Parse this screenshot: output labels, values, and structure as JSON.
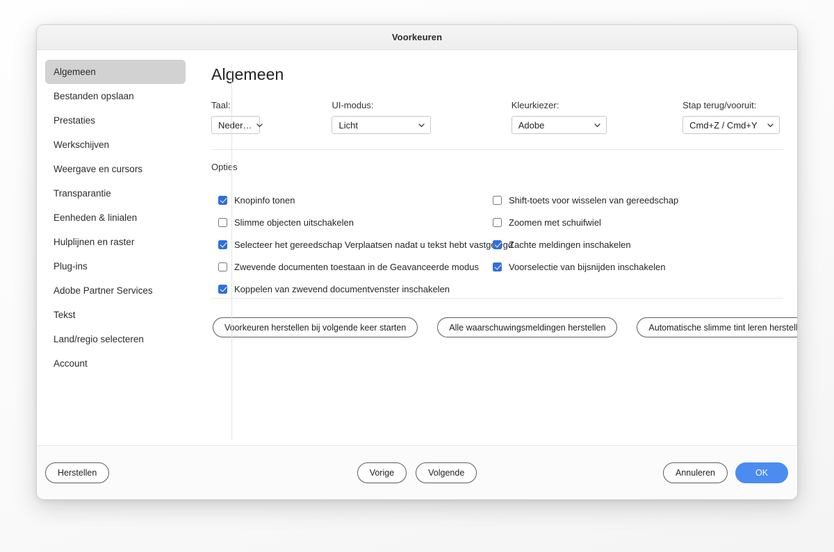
{
  "window": {
    "title": "Voorkeuren"
  },
  "sidebar": {
    "items": [
      {
        "label": "Algemeen",
        "selected": true
      },
      {
        "label": "Bestanden opslaan",
        "selected": false
      },
      {
        "label": "Prestaties",
        "selected": false
      },
      {
        "label": "Werkschijven",
        "selected": false
      },
      {
        "label": "Weergave en cursors",
        "selected": false
      },
      {
        "label": "Transparantie",
        "selected": false
      },
      {
        "label": "Eenheden & linialen",
        "selected": false
      },
      {
        "label": "Hulplijnen en raster",
        "selected": false
      },
      {
        "label": "Plug-ins",
        "selected": false
      },
      {
        "label": "Adobe Partner Services",
        "selected": false
      },
      {
        "label": "Tekst",
        "selected": false
      },
      {
        "label": "Land/regio selecteren",
        "selected": false
      },
      {
        "label": "Account",
        "selected": false
      }
    ]
  },
  "content": {
    "heading": "Algemeen",
    "selects": [
      {
        "label": "Taal:",
        "value": "Neder…"
      },
      {
        "label": "UI-modus:",
        "value": "Licht"
      },
      {
        "label": "Kleurkiezer:",
        "value": "Adobe"
      },
      {
        "label": "Stap terug/vooruit:",
        "value": "Cmd+Z / Cmd+Y"
      }
    ],
    "options_label": "Opties",
    "checkboxes_left": [
      {
        "label": "Knopinfo tonen",
        "checked": true
      },
      {
        "label": "Slimme objecten uitschakelen",
        "checked": false
      },
      {
        "label": "Selecteer het gereedschap Verplaatsen nadat u tekst hebt vastgelegd",
        "checked": true
      },
      {
        "label": "Zwevende documenten toestaan in de Geavanceerde modus",
        "checked": false
      },
      {
        "label": "Koppelen van zwevend documentvenster inschakelen",
        "checked": true
      }
    ],
    "checkboxes_right": [
      {
        "label": "Shift-toets voor wisselen van gereedschap",
        "checked": false
      },
      {
        "label": "Zoomen met schuifwiel",
        "checked": false
      },
      {
        "label": "Zachte meldingen inschakelen",
        "checked": true
      },
      {
        "label": "Voorselectie van bijsnijden inschakelen",
        "checked": true
      }
    ],
    "reset_buttons": [
      "Voorkeuren herstellen bij volgende keer starten",
      "Alle waarschuwingsmeldingen herstellen",
      "Automatische slimme tint leren herstellen"
    ]
  },
  "footer": {
    "reset": "Herstellen",
    "previous": "Vorige",
    "next": "Volgende",
    "cancel": "Annuleren",
    "ok": "OK"
  },
  "colors": {
    "accent": "#4a8cf0",
    "checkbox_on": "#2f6fdb",
    "selected_nav": "#d2d2d2"
  }
}
